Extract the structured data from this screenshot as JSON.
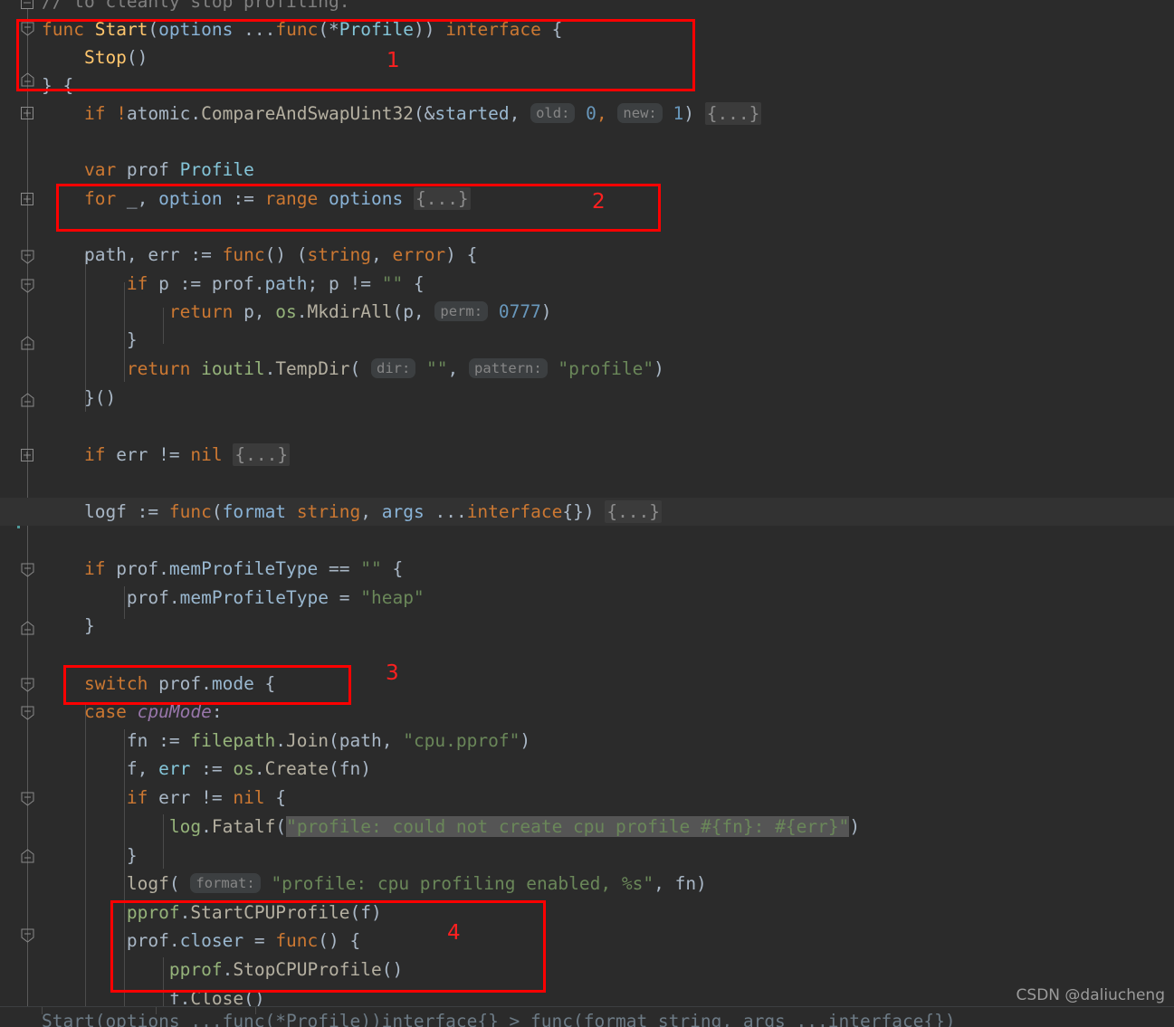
{
  "app": {
    "theme": "darcula",
    "background": "#2b2b2b",
    "caret_line_background": "#323232",
    "annotation_color": "#fe0000"
  },
  "watermark": {
    "text": "CSDN @daliucheng"
  },
  "code": {
    "language": "go",
    "lines": [
      {
        "n": 0,
        "text": "// to cleanly stop profiling.",
        "clipped_top": true
      },
      {
        "n": 1,
        "text": "func Start(options ...func(*Profile)) interface {"
      },
      {
        "n": 2,
        "text": "    Stop()"
      },
      {
        "n": 3,
        "text": "} {"
      },
      {
        "n": 4,
        "text": "    if !atomic.CompareAndSwapUint32(&started, old: 0, new: 1) {...}"
      },
      {
        "n": 5,
        "text": ""
      },
      {
        "n": 6,
        "text": "    var prof Profile"
      },
      {
        "n": 7,
        "text": "    for _, option := range options {...}"
      },
      {
        "n": 8,
        "text": ""
      },
      {
        "n": 9,
        "text": "    path, err := func() (string, error) {"
      },
      {
        "n": 10,
        "text": "        if p := prof.path; p != \"\" {"
      },
      {
        "n": 11,
        "text": "            return p, os.MkdirAll(p, perm: 0777)"
      },
      {
        "n": 12,
        "text": "        }"
      },
      {
        "n": 13,
        "text": "        return ioutil.TempDir( dir: \"\", pattern: \"profile\")"
      },
      {
        "n": 14,
        "text": "    }()"
      },
      {
        "n": 15,
        "text": ""
      },
      {
        "n": 16,
        "text": "    if err != nil {...}"
      },
      {
        "n": 17,
        "text": ""
      },
      {
        "n": 18,
        "text": "    logf := func(format string, args ...interface{}) {...}",
        "caret": true
      },
      {
        "n": 19,
        "text": ""
      },
      {
        "n": 20,
        "text": "    if prof.memProfileType == \"\" {"
      },
      {
        "n": 21,
        "text": "        prof.memProfileType = \"heap\""
      },
      {
        "n": 22,
        "text": "    }"
      },
      {
        "n": 23,
        "text": ""
      },
      {
        "n": 24,
        "text": "    switch prof.mode {"
      },
      {
        "n": 25,
        "text": "    case cpuMode:"
      },
      {
        "n": 26,
        "text": "        fn := filepath.Join(path, \"cpu.pprof\")"
      },
      {
        "n": 27,
        "text": "        f, err := os.Create(fn)"
      },
      {
        "n": 28,
        "text": "        if err != nil {"
      },
      {
        "n": 29,
        "text": "            log.Fatalf(\"profile: could not create cpu profile #{fn}: #{err}\")"
      },
      {
        "n": 30,
        "text": "        }"
      },
      {
        "n": 31,
        "text": "        logf( format: \"profile: cpu profiling enabled, %s\", fn)"
      },
      {
        "n": 32,
        "text": "        pprof.StartCPUProfile(f)"
      },
      {
        "n": 33,
        "text": "        prof.closer = func() {"
      },
      {
        "n": 34,
        "text": "            pprof.StopCPUProfile()"
      },
      {
        "n": 35,
        "text": "            f.Close()",
        "clipped_bottom": true
      }
    ],
    "inlay_hints": [
      "old:",
      "new:",
      "perm:",
      "dir:",
      "pattern:",
      "format:"
    ],
    "folded_placeholders": "{...}",
    "highlighted_text": "\"profile: could not create cpu profile #{fn}: #{err}\""
  },
  "annotations": [
    {
      "label": "1",
      "covers": "func Start(options ...func(*Profile)) interface { Stop() } {"
    },
    {
      "label": "2",
      "covers": "for _, option := range options {...}"
    },
    {
      "label": "3",
      "covers": "switch prof.mode {"
    },
    {
      "label": "4",
      "covers": "pprof.StartCPUProfile(f) / prof.closer = func() { / pprof.StopCPUProfile()"
    }
  ],
  "bottom_strip": {
    "text": "Start(options ...func(*Profile))interface{} > func(format string, args ...interface{})"
  }
}
